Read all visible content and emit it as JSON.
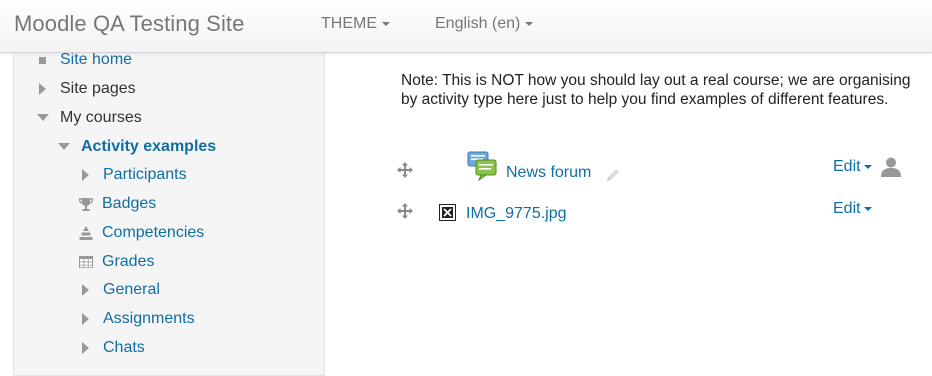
{
  "navbar": {
    "brand": "Moodle QA Testing Site",
    "theme_label": "THEME",
    "language_label": "English (en)"
  },
  "sidebar": {
    "items": [
      {
        "label": "Site home",
        "icon": "bullet-icon"
      },
      {
        "label": "Site pages",
        "icon": "expand-arrow-icon"
      },
      {
        "label": "My courses",
        "icon": "collapse-arrow-icon"
      },
      {
        "label": "Activity examples",
        "icon": "collapse-arrow-icon"
      },
      {
        "label": "Participants",
        "icon": "expand-arrow-icon"
      },
      {
        "label": "Badges",
        "icon": "trophy-icon"
      },
      {
        "label": "Competencies",
        "icon": "competencies-icon"
      },
      {
        "label": "Grades",
        "icon": "grades-table-icon"
      },
      {
        "label": "General",
        "icon": "expand-arrow-icon"
      },
      {
        "label": "Assignments",
        "icon": "expand-arrow-icon"
      },
      {
        "label": "Chats",
        "icon": "expand-arrow-icon"
      }
    ]
  },
  "main": {
    "note": "Note: This is NOT how you should lay out a real course; we are organising by activity type here just to help you find examples of different features.",
    "activities": [
      {
        "name": "News forum",
        "edit_label": "Edit",
        "icon": "forum-icon"
      },
      {
        "name": "IMG_9775.jpg",
        "edit_label": "Edit",
        "icon": "broken-image-icon"
      }
    ]
  },
  "colors": {
    "link": "#0f6fa3",
    "navbar_text": "#777777",
    "sidebar_bg": "#f5f5f5"
  }
}
